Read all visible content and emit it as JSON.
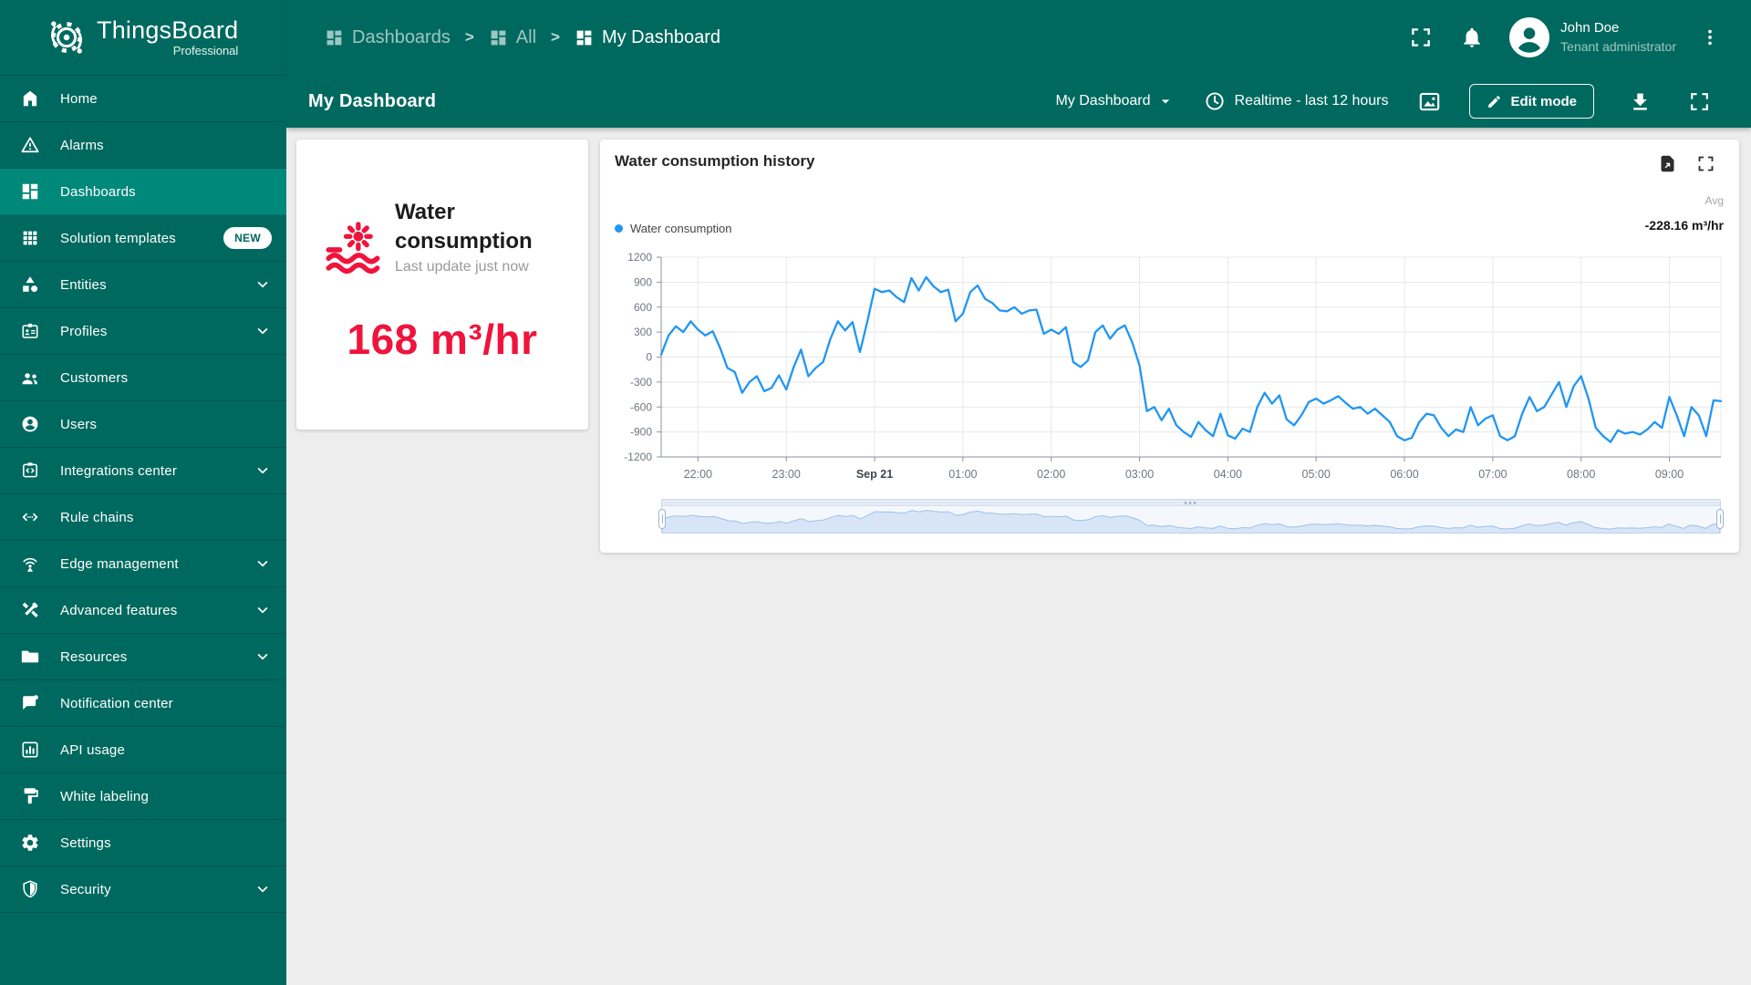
{
  "app": {
    "name": "ThingsBoard",
    "edition": "Professional"
  },
  "colors": {
    "primary_teal": "#00695f",
    "active_item_teal": "#00897b",
    "accent_red": "#f0143c",
    "chart_blue": "#2196f3",
    "minimap_fill": "#d8e5f7"
  },
  "breadcrumb": {
    "separator": ">",
    "items": [
      {
        "label": "Dashboards",
        "icon": "dashboards",
        "active": false
      },
      {
        "label": "All",
        "icon": "dashboards",
        "active": false
      },
      {
        "label": "My Dashboard",
        "icon": "dashboards",
        "active": true
      }
    ]
  },
  "user": {
    "name": "John Doe",
    "role": "Tenant administrator"
  },
  "header_icons": [
    "fullscreen-icon",
    "bell-icon",
    "avatar",
    "kebab-menu-icon"
  ],
  "sidebar": {
    "items": [
      {
        "label": "Home",
        "icon": "home"
      },
      {
        "label": "Alarms",
        "icon": "alarms"
      },
      {
        "label": "Dashboards",
        "icon": "dashboards",
        "active": true
      },
      {
        "label": "Solution templates",
        "icon": "templates",
        "badge": "NEW"
      },
      {
        "label": "Entities",
        "icon": "entities",
        "expandable": true
      },
      {
        "label": "Profiles",
        "icon": "profiles",
        "expandable": true
      },
      {
        "label": "Customers",
        "icon": "customers"
      },
      {
        "label": "Users",
        "icon": "users"
      },
      {
        "label": "Integrations center",
        "icon": "integrations",
        "expandable": true
      },
      {
        "label": "Rule chains",
        "icon": "rule-chains"
      },
      {
        "label": "Edge management",
        "icon": "edge",
        "expandable": true
      },
      {
        "label": "Advanced features",
        "icon": "advanced",
        "expandable": true
      },
      {
        "label": "Resources",
        "icon": "folder",
        "expandable": true
      },
      {
        "label": "Notification center",
        "icon": "notification"
      },
      {
        "label": "API usage",
        "icon": "api-usage"
      },
      {
        "label": "White labeling",
        "icon": "white-labeling"
      },
      {
        "label": "Settings",
        "icon": "gear"
      },
      {
        "label": "Security",
        "icon": "shield",
        "expandable": true
      }
    ]
  },
  "toolbar": {
    "page_title": "My Dashboard",
    "dashboard_select": "My Dashboard",
    "timewindow": "Realtime - last 12 hours",
    "edit_button": "Edit mode"
  },
  "widgets": {
    "value_card": {
      "title": "Water consumption",
      "subtitle": "Last update just now",
      "value": "168 m³/hr",
      "icon": "water-sun-waves-icon"
    },
    "history_chart": {
      "title": "Water consumption history",
      "legend_label": "Water consumption",
      "agg_label": "Avg",
      "agg_value": "-228.16 m³/hr",
      "header_icons": [
        "export-file-icon",
        "fullscreen-icon"
      ]
    }
  },
  "chart_data": {
    "type": "line",
    "title": "Water consumption history",
    "series_name": "Water consumption",
    "unit": "m³/hr",
    "color": "#2196f3",
    "avg_value": -228.16,
    "x_start": "21:35",
    "x_end": "09:35",
    "step_minutes": 5,
    "ylim": [
      -1200,
      1200
    ],
    "y_ticks": [
      1200,
      900,
      600,
      300,
      0,
      -300,
      -600,
      -900,
      -1200
    ],
    "x_ticks": {
      "labels": [
        "22:00",
        "23:00",
        "Sep 21",
        "01:00",
        "02:00",
        "03:00",
        "04:00",
        "05:00",
        "06:00",
        "07:00",
        "08:00",
        "09:00"
      ],
      "first_index": 5,
      "index_step": 12,
      "emphasized": "Sep 21"
    },
    "grid": true,
    "legend_position": "top-left",
    "range_selector": {
      "visible": true,
      "selected": "full"
    },
    "values": [
      30,
      260,
      370,
      300,
      430,
      330,
      260,
      310,
      110,
      -130,
      -180,
      -430,
      -300,
      -230,
      -410,
      -370,
      -220,
      -390,
      -120,
      90,
      -230,
      -130,
      -60,
      220,
      430,
      320,
      420,
      60,
      420,
      820,
      780,
      800,
      720,
      660,
      950,
      800,
      960,
      850,
      780,
      810,
      430,
      520,
      780,
      860,
      700,
      650,
      560,
      550,
      600,
      520,
      560,
      570,
      280,
      330,
      280,
      360,
      -60,
      -120,
      -40,
      300,
      380,
      220,
      330,
      380,
      180,
      -100,
      -650,
      -600,
      -760,
      -620,
      -820,
      -900,
      -960,
      -780,
      -880,
      -950,
      -680,
      -940,
      -980,
      -860,
      -900,
      -600,
      -430,
      -560,
      -460,
      -750,
      -820,
      -700,
      -540,
      -500,
      -560,
      -520,
      -470,
      -550,
      -620,
      -600,
      -680,
      -620,
      -700,
      -780,
      -950,
      -1000,
      -970,
      -780,
      -680,
      -700,
      -850,
      -950,
      -870,
      -900,
      -600,
      -820,
      -740,
      -700,
      -950,
      -1000,
      -950,
      -680,
      -480,
      -650,
      -600,
      -450,
      -300,
      -600,
      -350,
      -230,
      -500,
      -850,
      -950,
      -1020,
      -880,
      -920,
      -900,
      -930,
      -870,
      -780,
      -850,
      -480,
      -700,
      -950,
      -600,
      -700,
      -950,
      -520,
      -530
    ]
  }
}
